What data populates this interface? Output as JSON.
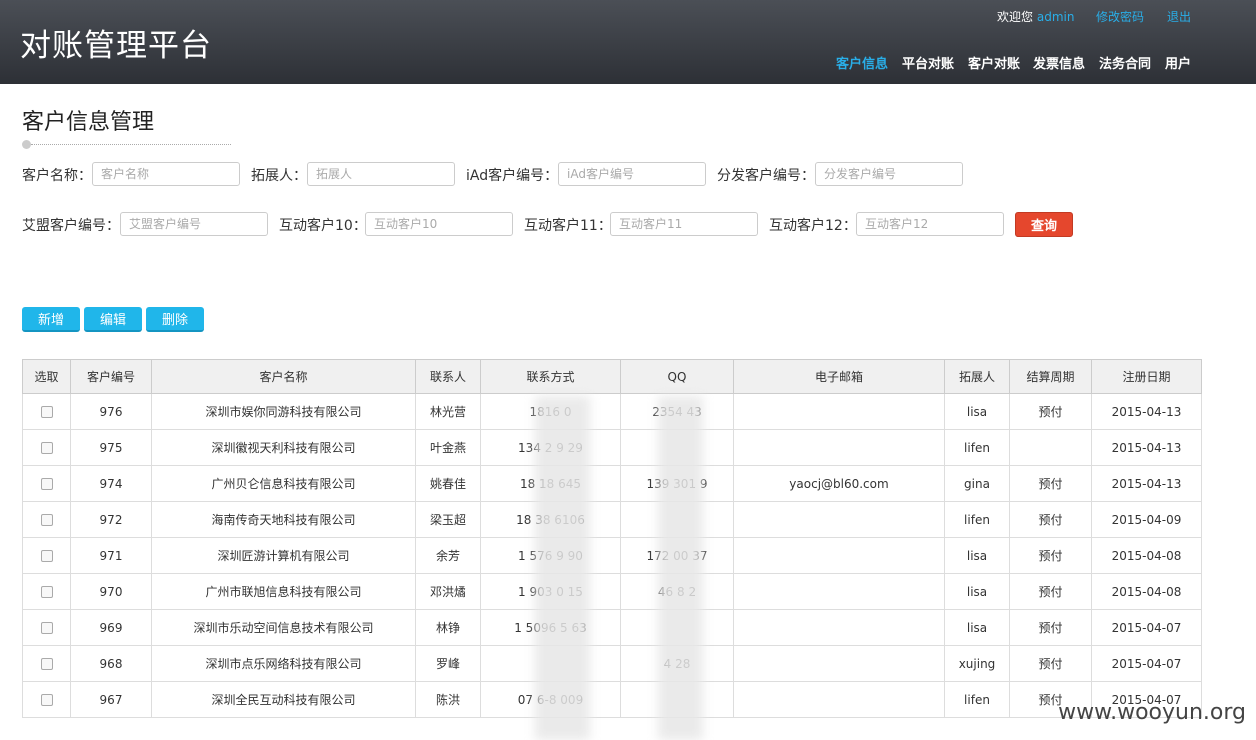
{
  "header": {
    "brand": "对账管理平台",
    "welcome": "欢迎您",
    "username": "admin",
    "change_password": "修改密码",
    "logout": "退出",
    "nav": [
      "客户信息",
      "平台对账",
      "客户对账",
      "发票信息",
      "法务合同",
      "用户"
    ]
  },
  "page": {
    "title": "客户信息管理"
  },
  "filters": {
    "row1": [
      {
        "label": "客户名称：",
        "placeholder": "客户名称"
      },
      {
        "label": "拓展人：",
        "placeholder": "拓展人"
      },
      {
        "label": "iAd客户编号：",
        "placeholder": "iAd客户编号"
      },
      {
        "label": "分发客户编号：",
        "placeholder": "分发客户编号"
      }
    ],
    "row2": [
      {
        "label": "艾盟客户编号：",
        "placeholder": "艾盟客户编号"
      },
      {
        "label": "互动客户10：",
        "placeholder": "互动客户10"
      },
      {
        "label": "互动客户11：",
        "placeholder": "互动客户11"
      },
      {
        "label": "互动客户12：",
        "placeholder": "互动客户12"
      }
    ],
    "query_label": "查询"
  },
  "actions": {
    "add": "新增",
    "edit": "编辑",
    "delete": "删除"
  },
  "table": {
    "headers": [
      "选取",
      "客户编号",
      "客户名称",
      "联系人",
      "联系方式",
      "QQ",
      "电子邮箱",
      "拓展人",
      "结算周期",
      "注册日期"
    ],
    "rows": [
      {
        "id": "976",
        "name": "深圳市娱你同游科技有限公司",
        "contact": "林光营",
        "phone": "1816   0",
        "qq": "2354   43",
        "email": "",
        "ext": "lisa",
        "cycle": "预付",
        "date": "2015-04-13"
      },
      {
        "id": "975",
        "name": "深圳徽视天利科技有限公司",
        "contact": "叶金燕",
        "phone": "134   2 9  29",
        "qq": "",
        "email": "",
        "ext": "lifen",
        "cycle": "",
        "date": "2015-04-13"
      },
      {
        "id": "974",
        "name": "广州贝仑信息科技有限公司",
        "contact": "姚春佳",
        "phone": "18 18   645",
        "qq": "139   301 9",
        "email": "yaocj@bl60.com",
        "ext": "gina",
        "cycle": "预付",
        "date": "2015-04-13"
      },
      {
        "id": "972",
        "name": "海南传奇天地科技有限公司",
        "contact": "梁玉超",
        "phone": "18 38   6106",
        "qq": "",
        "email": "",
        "ext": "lifen",
        "cycle": "预付",
        "date": "2015-04-09"
      },
      {
        "id": "971",
        "name": "深圳匠游计算机有限公司",
        "contact": "余芳",
        "phone": "1 576   9 90",
        "qq": "172   00 37",
        "email": "",
        "ext": "lisa",
        "cycle": "预付",
        "date": "2015-04-08"
      },
      {
        "id": "970",
        "name": "广州市联旭信息科技有限公司",
        "contact": "邓洪燏",
        "phone": "1 903   0 15",
        "qq": "46   8 2",
        "email": "",
        "ext": "lisa",
        "cycle": "预付",
        "date": "2015-04-08"
      },
      {
        "id": "969",
        "name": "深圳市乐动空间信息技术有限公司",
        "contact": "林铮",
        "phone": "1 5096   5 63",
        "qq": "",
        "email": "",
        "ext": "lisa",
        "cycle": "预付",
        "date": "2015-04-07"
      },
      {
        "id": "968",
        "name": "深圳市点乐网络科技有限公司",
        "contact": "罗峰",
        "phone": "",
        "qq": "4   28",
        "email": "",
        "ext": "xujing",
        "cycle": "预付",
        "date": "2015-04-07"
      },
      {
        "id": "967",
        "name": "深圳全民互动科技有限公司",
        "contact": "陈洪",
        "phone": "07 6-8   009",
        "qq": "",
        "email": "",
        "ext": "lifen",
        "cycle": "预付",
        "date": "2015-04-07"
      }
    ]
  },
  "watermark": "www.wooyun.org"
}
